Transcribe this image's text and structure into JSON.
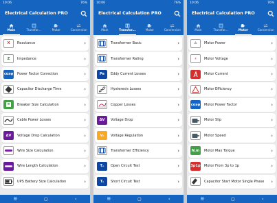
{
  "phones": [
    {
      "status_time": "10:06",
      "status_battery": "76%",
      "title": "Electrical Calculation PRO",
      "active_tab": 0,
      "tabs": [
        "Main",
        "Transfor...",
        "Motor",
        "Conversion"
      ],
      "items": [
        {
          "label": "Reactance",
          "icon": "reactance-x-icon",
          "text": "X",
          "bg": "#ffffff",
          "fg": "#d32f2f"
        },
        {
          "label": "Impedance",
          "icon": "impedance-z-icon",
          "text": "Z",
          "bg": "#ffffff",
          "fg": "#2e7d32"
        },
        {
          "label": "Power Factor Correction",
          "icon": "power-factor-correction-icon",
          "text": "cosφ",
          "bg": "#1565c0",
          "fg": "#ffffff"
        },
        {
          "label": "Capacitor Discharge Time",
          "icon": "capacitor-icon",
          "text": "",
          "bg": "#ffffff",
          "fg": "#333333"
        },
        {
          "label": "Breaker Size Calculation",
          "icon": "breaker-icon",
          "text": "",
          "bg": "#43a047",
          "fg": "#ffffff"
        },
        {
          "label": "Cable Power Losses",
          "icon": "cable-icon",
          "text": "",
          "bg": "#ffffff",
          "fg": "#333333"
        },
        {
          "label": "Voltage Drop Calculation",
          "icon": "voltage-drop-icon",
          "text": "ΔV",
          "bg": "#6a1b9a",
          "fg": "#ffffff"
        },
        {
          "label": "Wire Size Calculation",
          "icon": "wire-size-icon",
          "text": "",
          "bg": "#ffffff",
          "fg": "#7b1fa2"
        },
        {
          "label": "Wire Length Calculation",
          "icon": "wire-length-icon",
          "text": "",
          "bg": "#6a1b9a",
          "fg": "#ffffff"
        },
        {
          "label": "UPS Battery Size Calculation",
          "icon": "ups-battery-icon",
          "text": "",
          "bg": "#ffffff",
          "fg": "#333333"
        }
      ]
    },
    {
      "status_time": "10:06",
      "status_battery": "76%",
      "title": "Electrical Calculation PRO",
      "active_tab": 1,
      "tabs": [
        "Main",
        "Transfor...",
        "Motor",
        "Conversion"
      ],
      "items": [
        {
          "label": "Transformer Basic",
          "icon": "transformer-basic-icon",
          "text": "",
          "bg": "#ffffff",
          "fg": "#0d47a1"
        },
        {
          "label": "Transformer Rating",
          "icon": "transformer-rating-icon",
          "text": "",
          "bg": "#ffffff",
          "fg": "#0d47a1"
        },
        {
          "label": "Eddy Current Losses",
          "icon": "eddy-current-icon",
          "text": "Pe",
          "bg": "#0d47a1",
          "fg": "#ffffff"
        },
        {
          "label": "Hysteresis Losses",
          "icon": "hysteresis-icon",
          "text": "",
          "bg": "#ffffff",
          "fg": "#555555"
        },
        {
          "label": "Copper Losses",
          "icon": "copper-losses-icon",
          "text": "",
          "bg": "#ffffff",
          "fg": "#c2185b"
        },
        {
          "label": "Voltage Drop",
          "icon": "voltage-drop-icon",
          "text": "ΔV",
          "bg": "#6a1b9a",
          "fg": "#ffffff"
        },
        {
          "label": "Voltage Regulation",
          "icon": "voltage-regulation-icon",
          "text": "Vᵣ",
          "bg": "#f9a825",
          "fg": "#ffffff"
        },
        {
          "label": "Transformer Efficiency",
          "icon": "transformer-efficiency-icon",
          "text": "",
          "bg": "#ffffff",
          "fg": "#0d47a1"
        },
        {
          "label": "Open Circuit Test",
          "icon": "open-circuit-test-icon",
          "text": "Tₒ",
          "bg": "#0d47a1",
          "fg": "#ffffff"
        },
        {
          "label": "Short Circuit Test",
          "icon": "short-circuit-test-icon",
          "text": "Tₛ",
          "bg": "#0d47a1",
          "fg": "#ffffff"
        }
      ]
    },
    {
      "status_time": "10:06",
      "status_battery": "76%",
      "title": "Electrical Calculation PRO",
      "active_tab": 2,
      "tabs": [
        "Main",
        "Transfor...",
        "Motor",
        "Conversion"
      ],
      "items": [
        {
          "label": "Motor Power",
          "icon": "motor-power-icon",
          "text": "⚠",
          "bg": "#ffffff",
          "fg": "#222222"
        },
        {
          "label": "Motor Voltage",
          "icon": "motor-voltage-icon",
          "text": "⚡",
          "bg": "#ffffff",
          "fg": "#d32f2f"
        },
        {
          "label": "Motor Current",
          "icon": "motor-current-icon",
          "text": "",
          "bg": "#d32f2f",
          "fg": "#ffffff"
        },
        {
          "label": "Motor Efficiency",
          "icon": "motor-efficiency-icon",
          "text": "",
          "bg": "#ffffff",
          "fg": "#d32f2f"
        },
        {
          "label": "Motor Power Factor",
          "icon": "motor-power-factor-icon",
          "text": "cosφ",
          "bg": "#1565c0",
          "fg": "#ffffff"
        },
        {
          "label": "Motor Slip",
          "icon": "motor-slip-icon",
          "text": "",
          "bg": "#ffffff",
          "fg": "#455a64"
        },
        {
          "label": "Motor Speed",
          "icon": "motor-speed-icon",
          "text": "",
          "bg": "#ffffff",
          "fg": "#455a64"
        },
        {
          "label": "Motor Max Torque",
          "icon": "motor-max-torque-icon",
          "text": "N.m",
          "bg": "#43a047",
          "fg": "#ffffff"
        },
        {
          "label": "Motor From 3p to 1p",
          "icon": "motor-3p-to-1p-icon",
          "text": "3p1p",
          "bg": "#d32f2f",
          "fg": "#ffffff"
        },
        {
          "label": "Capacitor Start Motor Single Phase",
          "icon": "capacitor-start-motor-icon",
          "text": "",
          "bg": "#ffffff",
          "fg": "#333333"
        }
      ]
    }
  ]
}
